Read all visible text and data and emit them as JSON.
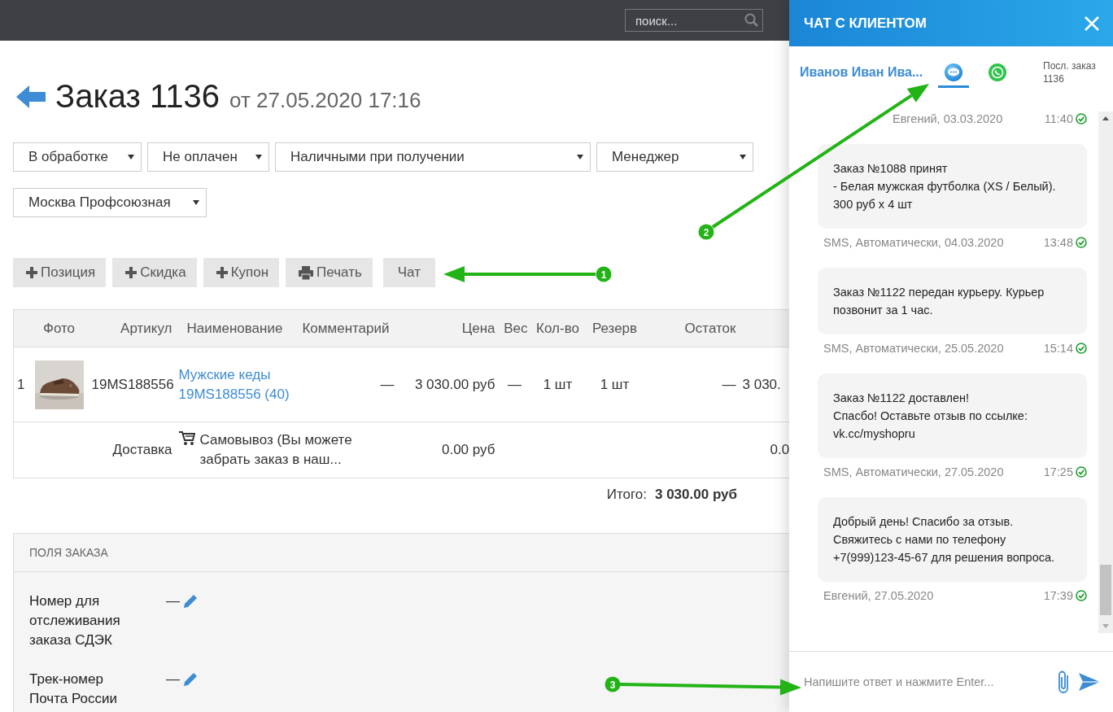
{
  "topbar": {
    "search": {
      "placeholder": "поиск..."
    }
  },
  "order": {
    "title": "Заказ 1136",
    "date": "от 27.05.2020 17:16"
  },
  "selects": [
    {
      "value": "В обработке"
    },
    {
      "value": "Не оплачен"
    },
    {
      "value": "Наличными при получении"
    },
    {
      "value": "Менеджер"
    },
    {
      "value": "Москва Профсоюзная"
    }
  ],
  "actions": [
    {
      "label": "Позиция",
      "kind": "plus"
    },
    {
      "label": "Скидка",
      "kind": "plus"
    },
    {
      "label": "Купон",
      "kind": "plus"
    },
    {
      "label": "Печать",
      "kind": "print"
    },
    {
      "label": "Чат",
      "kind": "plain"
    }
  ],
  "table": {
    "columns": [
      "Фото",
      "Артикул",
      "Наименование",
      "Комментарий",
      "Цена",
      "Вес",
      "Кол-во",
      "Резерв",
      "Остаток"
    ],
    "rows": [
      {
        "kind": "item",
        "number": "1",
        "article": "19MS188556",
        "name": "Мужские кеды 19MS188556 (40)",
        "comment": "—",
        "price": "3 030.00 руб",
        "weight": "—",
        "quantity": "1 шт",
        "reserve": "1 шт",
        "stock": "—",
        "column_10": "3 030."
      },
      {
        "kind": "delivery",
        "label": "Доставка",
        "name": "Самовывоз (Вы можете забрать заказ в наш...",
        "price": "0.00 руб",
        "column_10": "0.0"
      }
    ],
    "total": {
      "label": "Итого:",
      "value": "3 030.00 руб"
    }
  },
  "order_fields": {
    "title": "ПОЛЯ ЗАКАЗА",
    "fields": [
      {
        "label": "Номер для отслеживания заказа СДЭК",
        "value": "—"
      },
      {
        "label": "Трек-номер Почта России",
        "value": "—"
      }
    ]
  },
  "chat": {
    "title": "ЧАТ С КЛИЕНТОМ",
    "customer": "Иванов Иван Ива...",
    "channels": [
      {
        "kind": "sms",
        "selected": true
      },
      {
        "kind": "whatsapp",
        "selected": false
      }
    ],
    "last_order": {
      "label": "Посл. заказ",
      "number": "1136"
    },
    "messages": [
      {
        "meta": "Евгений, 03.03.2020",
        "time": "11:40",
        "delivered": true
      },
      {
        "text": "Заказ №1088 принят\n- Белая мужская футболка (XS / Белый). 300 руб x 4 шт",
        "meta": "SMS, Автоматически, 04.03.2020",
        "time": "13:48",
        "delivered": true
      },
      {
        "text": "Заказ №1122 передан курьеру. Курьер позвонит за 1 час.",
        "meta": "SMS, Автоматически, 25.05.2020",
        "time": "15:14",
        "delivered": true
      },
      {
        "text": "Заказ №1122 доставлен!\nСпасбо! Оставьте отзыв по ссылке: vk.cc/myshopru",
        "meta": "SMS, Автоматически, 27.05.2020",
        "time": "17:25",
        "delivered": true
      },
      {
        "text": "Добрый день! Спасибо за отзыв. Свяжитесь с нами по телефону +7(999)123-45-67 для решения вопроса.",
        "meta": "Евгений, 27.05.2020",
        "time": "17:39",
        "delivered": true
      }
    ],
    "input": {
      "placeholder": "Напишите ответ и нажмите Enter..."
    }
  },
  "annotations": [
    {
      "number": "1"
    },
    {
      "number": "2"
    },
    {
      "number": "3"
    }
  ]
}
